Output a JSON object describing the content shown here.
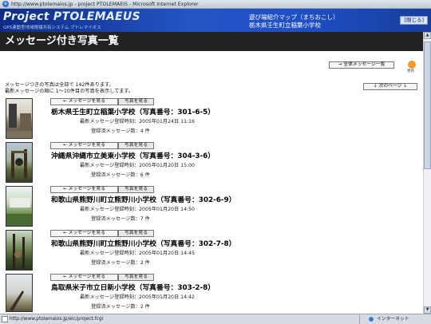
{
  "window": {
    "title": "http://www.ptolemaios.jp - project PTOLEMAEIS - Microsoft Internet Explorer"
  },
  "banner": {
    "logo": "Project PTOLEMAEUS",
    "logo_sub": "GPS連動型地域情報共有システム プトレマイオス",
    "title_line1": "遊び場紹介マップ（まちおこし）",
    "title_line2": "栃木県壬生町立稲葉小学校",
    "close_label": "[閉じる]"
  },
  "page": {
    "heading": "メッセージ付き写真一覧",
    "all_messages_label": "→ 全体メッセージ一覧",
    "refresh_label": "更新",
    "info_line1": "メッセージつきの写真は全部で 142件あります。",
    "info_line2": "最新メッセージの順に 1〜10件目の写真を表示してます。",
    "next_page_label": "↓ 次のページ ↓"
  },
  "entries": [
    {
      "view_label": "← メッセージを見る",
      "photo_label": "写真を見る",
      "school": "栃木県壬生町立稲葉小学校（写真番号：301-6-5）",
      "latest": "最新メッセージ登録時刻：2005年01月24日 11:16",
      "count": "登録済メッセージ数：4 件"
    },
    {
      "view_label": "← メッセージを見る",
      "photo_label": "写真を見る",
      "school": "沖縄県沖縄市立美東小学校（写真番号：304-3-6）",
      "latest": "最新メッセージ登録時刻：2005年01月20日 15:00",
      "count": "登録済メッセージ数：6 件"
    },
    {
      "view_label": "← メッセージを見る",
      "photo_label": "写真を見る",
      "school": "和歌山県熊野川町立熊野川小学校（写真番号：302-6-9）",
      "latest": "最新メッセージ登録時刻：2005年01月20日 14:50",
      "count": "登録済メッセージ数：7 件"
    },
    {
      "view_label": "← メッセージを見る",
      "photo_label": "写真を見る",
      "school": "和歌山県熊野川町立熊野川小学校（写真番号：302-7-8）",
      "latest": "最新メッセージ登録時刻：2005年01月20日 14:45",
      "count": "登録済メッセージ数：2 件"
    },
    {
      "view_label": "← メッセージを見る",
      "photo_label": "写真を見る",
      "school": "鳥取県米子市立日新小学校（写真番号：303-2-8）",
      "latest": "最新メッセージ登録時刻：2005年01月20日 14:42",
      "count": "登録済メッセージ数：2 件"
    }
  ],
  "status": {
    "url": "http://www.ptolemaios.jp/eic/project.fcgi",
    "zone": "インターネット"
  },
  "colors": {
    "banner": "#1f4fc4",
    "heading_bg": "#222222",
    "refresh": "#f09b25"
  }
}
